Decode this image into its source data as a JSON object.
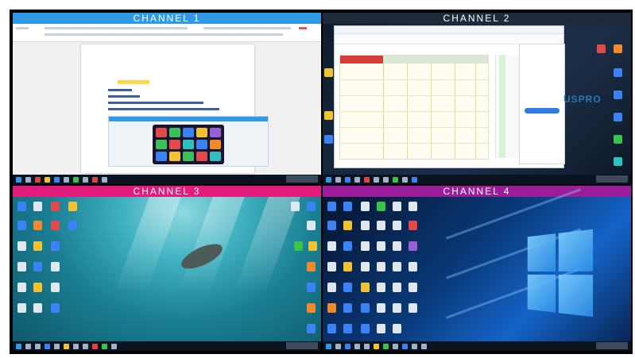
{
  "channels": [
    {
      "label": "CHANNEL  1"
    },
    {
      "label": "CHANNEL  2"
    },
    {
      "label": "CHANNEL  3"
    },
    {
      "label": "CHANNEL  4"
    }
  ],
  "channel2": {
    "watermark": "USPRO"
  },
  "colors": {
    "channel1_bar": "#2f9be6",
    "channel2_bar": "#1e2a3a",
    "channel3_bar": "#e21c7a",
    "channel4_bar": "#9a1e9a"
  }
}
